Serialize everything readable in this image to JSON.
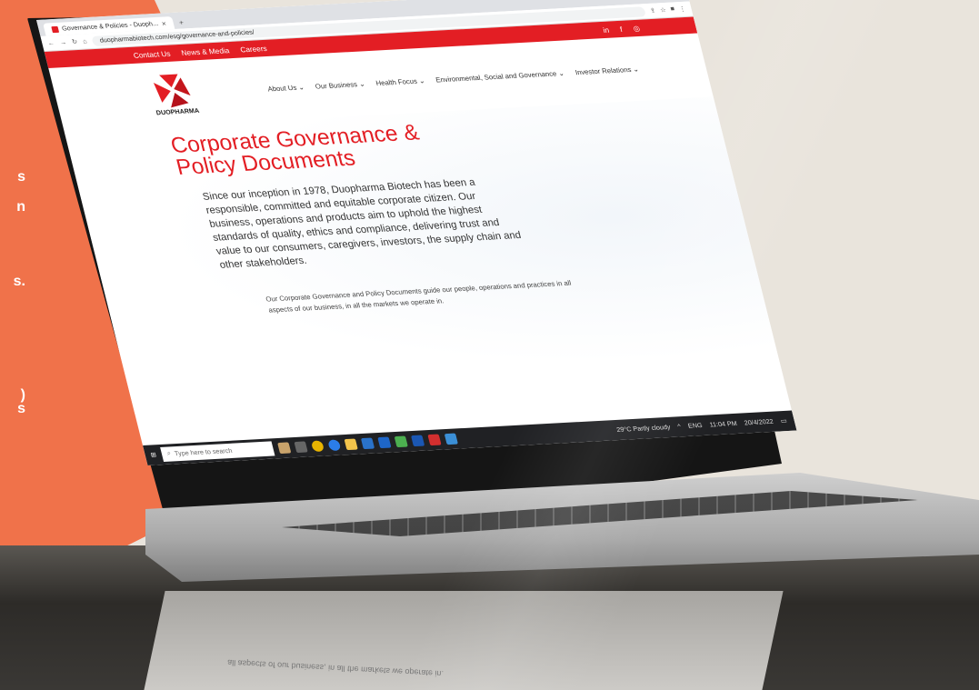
{
  "side_text": {
    "lines": [
      "s",
      "n",
      "",
      "",
      "s.",
      "",
      "",
      ")",
      "s"
    ]
  },
  "browser": {
    "tab_title": "Governance & Policies - Duoph...",
    "tab_close": "×",
    "new_tab": "+",
    "url": "duopharmabiotech.com/esg/governance-and-policies/",
    "window_controls": [
      "–",
      "▢",
      "×"
    ]
  },
  "site": {
    "topbar_links": [
      "Contact Us",
      "News & Media",
      "Careers"
    ],
    "social_icons": [
      "in",
      "f",
      "◎"
    ],
    "logo_text": "DUOPHARMA",
    "nav": [
      "About Us ⌄",
      "Our Business ⌄",
      "Health Focus ⌄",
      "Environmental, Social and Governance ⌄",
      "Investor Relations ⌄"
    ],
    "hero_title": "Corporate Governance & Policy Documents",
    "hero_body": "Since our inception in 1978, Duopharma Biotech has been a responsible, committed and equitable corporate citizen. Our business, operations and products aim to uphold the highest standards of quality, ethics and compliance, delivering trust and value to our consumers, caregivers, investors, the supply chain and other stakeholders.",
    "hero_note": "Our Corporate Governance and Policy Documents guide our people, operations and practices in all aspects of our business, in all the markets we operate in."
  },
  "taskbar": {
    "search_placeholder": "Type here to search",
    "weather": "29°C  Partly cloudy",
    "language": "ENG",
    "time": "11:04 PM",
    "date": "20/4/2022"
  },
  "reflection_text": "all aspects of our business, in all the markets we operate in.",
  "colors": {
    "brand_red": "#e31e24",
    "orange_panel": "#f0724a",
    "wall": "#e9e4dc"
  }
}
